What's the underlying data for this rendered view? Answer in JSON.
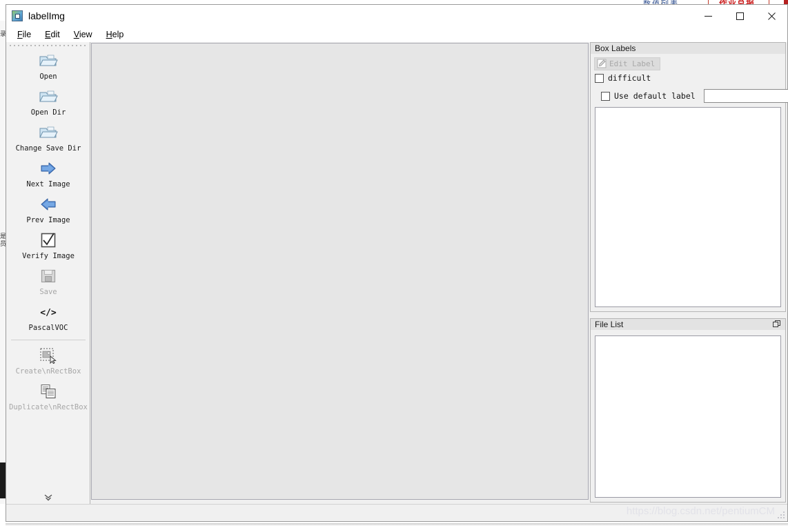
{
  "window": {
    "title": "labelImg",
    "app_icon": "labelimg-app-icon",
    "controls": {
      "minimize": "minimize-icon",
      "maximize": "maximize-icon",
      "close": "close-icon"
    }
  },
  "menu": {
    "items": [
      {
        "mnemonic": "F",
        "rest": "ile",
        "name": "menu-file"
      },
      {
        "mnemonic": "E",
        "rest": "dit",
        "name": "menu-edit"
      },
      {
        "mnemonic": "V",
        "rest": "iew",
        "name": "menu-view"
      },
      {
        "mnemonic": "H",
        "rest": "elp",
        "name": "menu-help"
      }
    ]
  },
  "toolbar": {
    "grip": "drag-handle",
    "expand_icon": "double-chevron-down-icon",
    "buttons": [
      {
        "label": "Open",
        "icon": "open-folder-icon",
        "enabled": true
      },
      {
        "label": "Open Dir",
        "icon": "open-folder-icon",
        "enabled": true
      },
      {
        "label": "Change Save Dir",
        "icon": "open-folder-icon",
        "enabled": true
      },
      {
        "label": "Next Image",
        "icon": "arrow-right-icon",
        "enabled": true
      },
      {
        "label": "Prev Image",
        "icon": "arrow-left-icon",
        "enabled": true
      },
      {
        "label": "Verify Image",
        "icon": "checkbox-checked-icon",
        "enabled": true
      },
      {
        "label": "Save",
        "icon": "floppy-disk-icon",
        "enabled": false
      },
      {
        "label": "PascalVOC",
        "icon": "code-tags-icon",
        "enabled": true
      },
      {
        "label": "Create\\nRectBox",
        "icon": "create-rectbox-icon",
        "enabled": false
      },
      {
        "label": "Duplicate\\nRectBox",
        "icon": "duplicate-rectbox-icon",
        "enabled": false
      }
    ]
  },
  "canvas": {
    "name": "image-canvas",
    "background_color": "#e6e6e6",
    "content": ""
  },
  "box_labels": {
    "title": "Box Labels",
    "edit_label_button": {
      "label": "Edit Label",
      "icon": "pencil-edit-icon",
      "enabled": false
    },
    "difficult_checkbox": {
      "label": "difficult",
      "checked": false
    },
    "use_default_label_checkbox": {
      "label": "Use default label",
      "checked": false
    },
    "default_label_input": {
      "value": "",
      "placeholder": ""
    },
    "labels": []
  },
  "file_list": {
    "title": "File List",
    "float_icon": "undock-float-icon",
    "files": []
  },
  "status_bar": {
    "text": ""
  },
  "watermark": {
    "text": "https://blog.csdn.net/pentiumCM"
  },
  "background": {
    "spreadsheet_blue_text": "数值列表",
    "spreadsheet_red_text": "作业总报",
    "left_panel_glyphs": [
      "录",
      "是",
      "员"
    ]
  },
  "colors": {
    "window_bg": "#f0f0f0",
    "canvas_bg": "#e6e6e6",
    "dock_title_bg": "#e3e3e3",
    "border": "#b5b5b5",
    "accent_blue": "#4a86c8",
    "disabled_text": "#a6a6a6",
    "watermark": "#e2e2e8"
  }
}
